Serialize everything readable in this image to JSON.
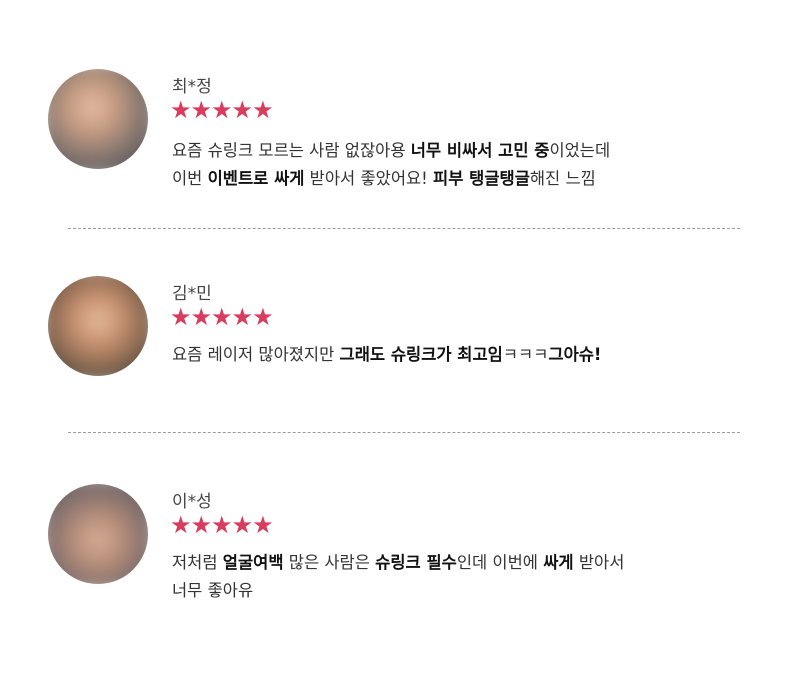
{
  "reviews": [
    {
      "name": "최*정",
      "rating": 5,
      "lines": [
        [
          {
            "t": "요즘 슈링크 모르는 사람 없잖아용 "
          },
          {
            "t": "너무 비싸서 고민 중",
            "b": true
          },
          {
            "t": "이었는데"
          }
        ],
        [
          {
            "t": "이번 "
          },
          {
            "t": "이벤트로 싸게",
            "b": true
          },
          {
            "t": " 받아서 좋았어요! "
          },
          {
            "t": "피부 탱글탱글",
            "b": true
          },
          {
            "t": "해진 느낌"
          }
        ]
      ]
    },
    {
      "name": "김*민",
      "rating": 5,
      "lines": [
        [
          {
            "t": "요즘 레이저 많아졌지만 "
          },
          {
            "t": "그래도 슈링크가 최고임",
            "b": true
          },
          {
            "t": "ㅋㅋㅋ"
          },
          {
            "t": "그아슈!",
            "b": true
          }
        ]
      ]
    },
    {
      "name": "이*성",
      "rating": 5,
      "lines": [
        [
          {
            "t": "저처럼 "
          },
          {
            "t": "얼굴여백",
            "b": true
          },
          {
            "t": " 많은 사람은 "
          },
          {
            "t": "슈링크 필수",
            "b": true
          },
          {
            "t": "인데 이번에 "
          },
          {
            "t": "싸게",
            "b": true
          },
          {
            "t": " 받아서"
          }
        ],
        [
          {
            "t": "너무 좋아유"
          }
        ]
      ]
    }
  ],
  "colors": {
    "star": "#d93c5c",
    "divider": "#9a9a9a",
    "text": "#333333"
  },
  "icons": {
    "star": "star-icon",
    "avatar": "user-avatar"
  },
  "star_glyph": "★"
}
